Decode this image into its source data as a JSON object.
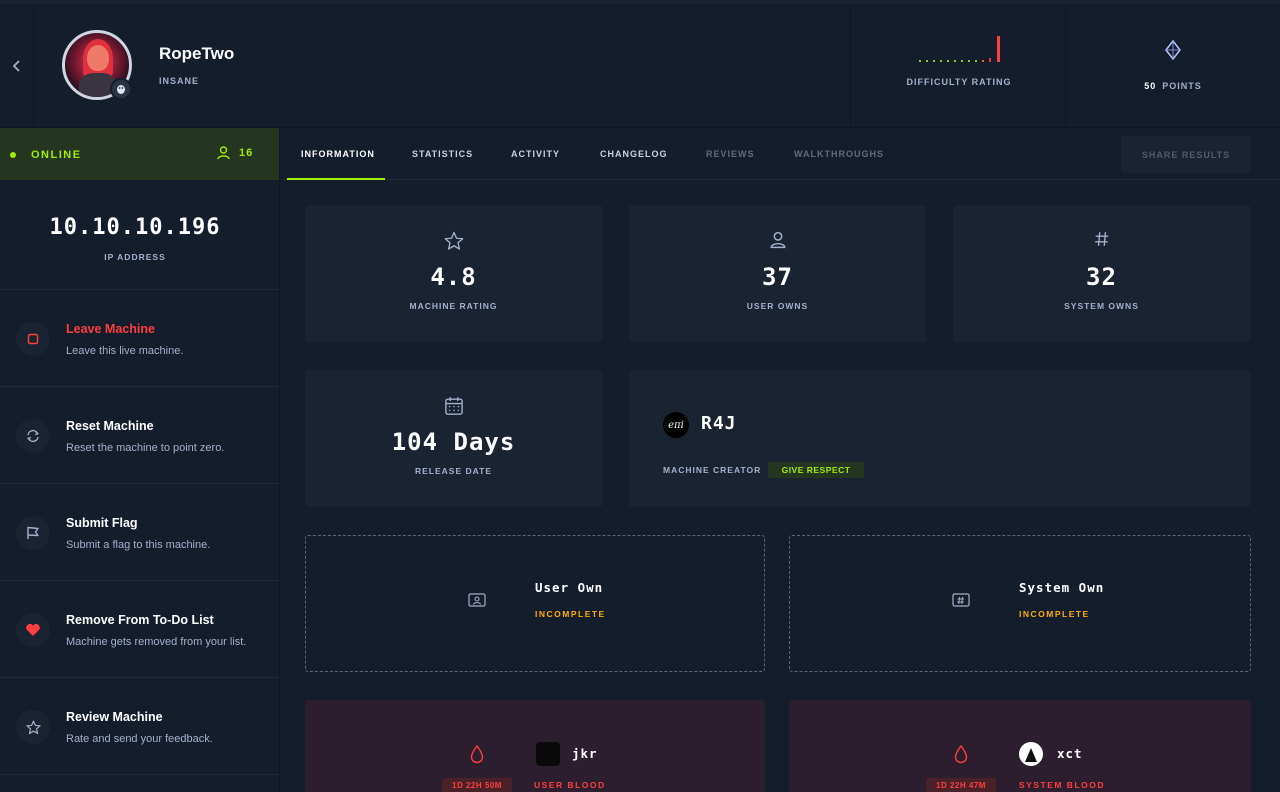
{
  "machine": {
    "name": "RopeTwo",
    "difficulty": "INSANE",
    "difficulty_label": "DIFFICULTY RATING",
    "points_value": "50",
    "points_label": "POINTS"
  },
  "sidebar": {
    "status": "ONLINE",
    "players": "16",
    "ip": "10.10.10.196",
    "ip_label": "IP ADDRESS",
    "actions": [
      {
        "title": "Leave Machine",
        "desc": "Leave this live machine.",
        "icon": "stop-icon"
      },
      {
        "title": "Reset Machine",
        "desc": "Reset the machine to point zero.",
        "icon": "reset-icon"
      },
      {
        "title": "Submit Flag",
        "desc": "Submit a flag to this machine.",
        "icon": "flag-icon"
      },
      {
        "title": "Remove From To-Do List",
        "desc": "Machine gets removed from your list.",
        "icon": "heart-icon"
      },
      {
        "title": "Review Machine",
        "desc": "Rate and send your feedback.",
        "icon": "star-icon"
      }
    ]
  },
  "tabs": [
    {
      "label": "INFORMATION"
    },
    {
      "label": "STATISTICS"
    },
    {
      "label": "ACTIVITY"
    },
    {
      "label": "CHANGELOG"
    },
    {
      "label": "REVIEWS"
    },
    {
      "label": "WALKTHROUGHS"
    }
  ],
  "share_label": "SHARE RESULTS",
  "stats": {
    "rating": {
      "value": "4.8",
      "label": "MACHINE RATING"
    },
    "user_owns": {
      "value": "37",
      "label": "USER OWNS"
    },
    "system_owns": {
      "value": "32",
      "label": "SYSTEM OWNS"
    },
    "release": {
      "value": "104 Days",
      "label": "RELEASE DATE"
    }
  },
  "creator": {
    "name": "R4J",
    "avatar_text": "eπi",
    "label": "MACHINE CREATOR",
    "respect_label": "GIVE RESPECT"
  },
  "owns": {
    "user": {
      "title": "User Own",
      "status": "INCOMPLETE"
    },
    "system": {
      "title": "System Own",
      "status": "INCOMPLETE"
    }
  },
  "bloods": {
    "user": {
      "time": "1D 22H 50M",
      "name": "jkr",
      "label": "USER BLOOD"
    },
    "system": {
      "time": "1D 22H 47M",
      "name": "xct",
      "label": "SYSTEM BLOOD"
    }
  },
  "colors": {
    "background": "#141d2b",
    "card": "#1a2332",
    "accent_green": "#9fef00",
    "danger_red": "#ff3e3e",
    "incomplete_orange": "#ffaf00"
  }
}
